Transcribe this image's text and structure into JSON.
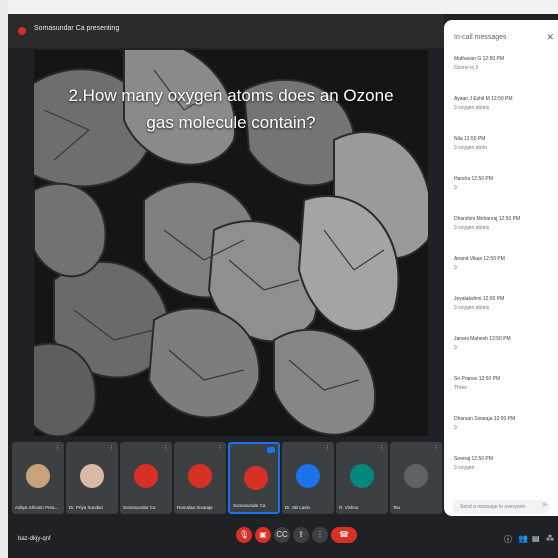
{
  "window": {
    "presenter_title": "Somasundar Ca presenting"
  },
  "slide": {
    "question": "2.How many oxygen atoms does an Ozone gas molecule contain?"
  },
  "chat": {
    "header": "In-call messages",
    "close_icon": "close-icon",
    "messages": [
      {
        "name": "Mathavan G 12:50 PM",
        "text": "Ozone is 3"
      },
      {
        "name": "Ayaan J Ezhil M 12:50 PM",
        "text": "3 oxygen atoms"
      },
      {
        "name": "Nila 12:50 PM",
        "text": "3 oxygen atom"
      },
      {
        "name": "Harsha 12:50 PM",
        "text": "3"
      },
      {
        "name": "Dharshini Mohanraj 12:50 PM",
        "text": "3 oxygen atoms"
      },
      {
        "name": "Anand Vikas 12:50 PM",
        "text": "3"
      },
      {
        "name": "Jeyalakshmi 12:50 PM",
        "text": "3 oxygen atoms"
      },
      {
        "name": "Janani Mahesh 12:50 PM",
        "text": "3"
      },
      {
        "name": "Sri Pranav 12:50 PM",
        "text": "Three"
      },
      {
        "name": "Dharsan Sivaraja 12:50 PM",
        "text": "3"
      },
      {
        "name": "Sreeraj 12:50 PM",
        "text": "3 oxygen"
      }
    ],
    "input_placeholder": "Send a message to everyone",
    "send_icon": "send-icon"
  },
  "participants": [
    {
      "name": "Aditya Shivam Prea...",
      "avatar_color": "#c8a27a",
      "state": "muted"
    },
    {
      "name": "Dr. Priya Sundari",
      "avatar_color": "#d9b8a4",
      "state": "muted"
    },
    {
      "name": "Somasundar Ca",
      "avatar_color": "#d93025",
      "state": "muted"
    },
    {
      "name": "Ramalaa Sivaraja",
      "avatar_color": "#d93025",
      "state": "muted"
    },
    {
      "name": "Somasundar Ca",
      "avatar_color": "#d93025",
      "state": "speaking"
    },
    {
      "name": "Dr. SB Lavin",
      "avatar_color": "#1a73e8",
      "state": "muted"
    },
    {
      "name": "R. Vishnu",
      "avatar_color": "#00897b",
      "state": "muted"
    },
    {
      "name": "Tsu",
      "avatar_color": "#5f6368",
      "state": "muted"
    }
  ],
  "bottombar": {
    "meeting_code": "baz-dkjy-qnf",
    "controls": [
      {
        "icon": "mic-off-icon",
        "glyph": "🎙",
        "style": "red"
      },
      {
        "icon": "camera-off-icon",
        "glyph": "▣",
        "style": "red"
      },
      {
        "icon": "captions-icon",
        "glyph": "CC",
        "style": "normal"
      },
      {
        "icon": "present-icon",
        "glyph": "⇪",
        "style": "normal"
      },
      {
        "icon": "more-options-icon",
        "glyph": "⋮",
        "style": "normal"
      },
      {
        "icon": "end-call-icon",
        "glyph": "☎",
        "style": "end"
      }
    ],
    "right_icons": [
      {
        "icon": "info-icon",
        "glyph": "ⓘ"
      },
      {
        "icon": "people-icon",
        "glyph": "👥"
      },
      {
        "icon": "chat-icon",
        "glyph": "▤"
      },
      {
        "icon": "activities-icon",
        "glyph": "⁂"
      }
    ]
  },
  "colors": {
    "accent": "#1a73e8",
    "danger": "#d93025",
    "surface": "#202124"
  }
}
